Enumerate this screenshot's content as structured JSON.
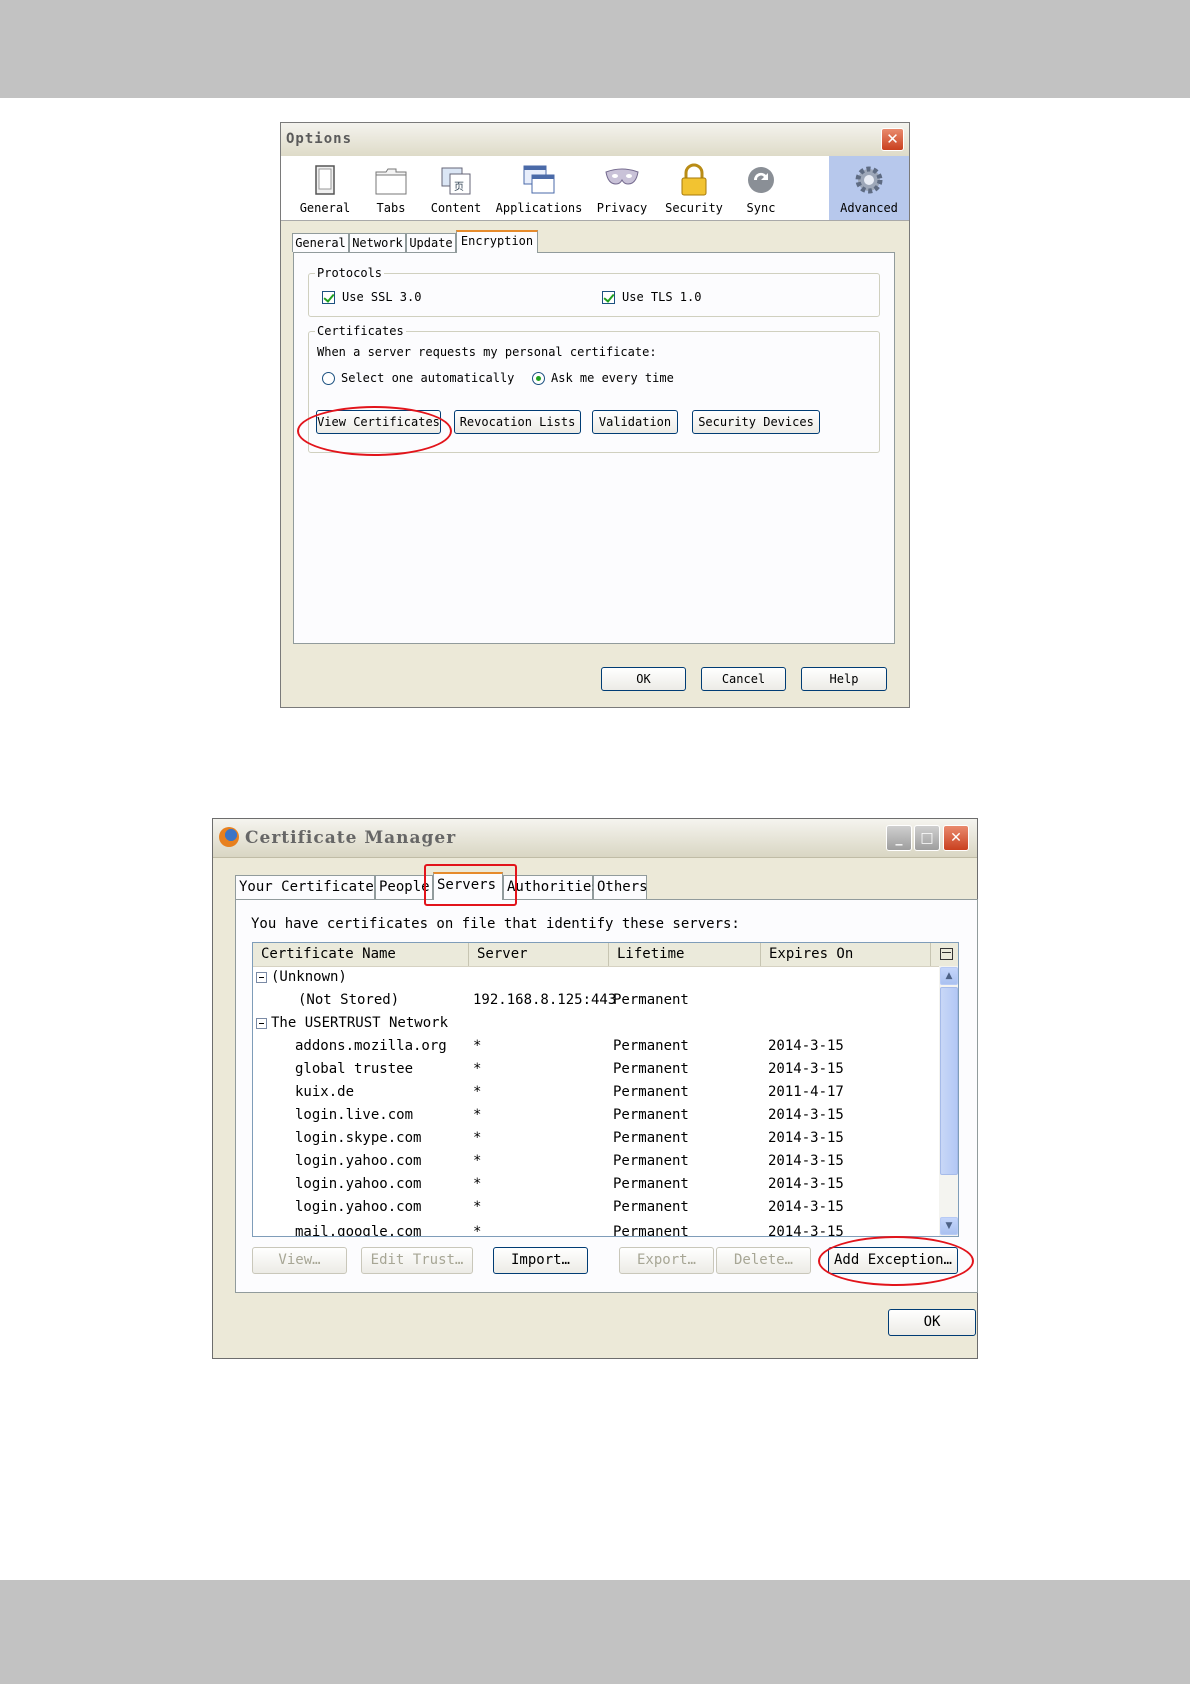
{
  "options_window": {
    "title": "Options",
    "close_glyph": "✕",
    "panels": [
      {
        "label": "General",
        "icon": "general-icon"
      },
      {
        "label": "Tabs",
        "icon": "tabs-icon"
      },
      {
        "label": "Content",
        "icon": "content-icon"
      },
      {
        "label": "Applications",
        "icon": "applications-icon"
      },
      {
        "label": "Privacy",
        "icon": "privacy-icon"
      },
      {
        "label": "Security",
        "icon": "security-icon"
      },
      {
        "label": "Sync",
        "icon": "sync-icon"
      },
      {
        "label": "Advanced",
        "icon": "advanced-icon",
        "selected": true
      }
    ],
    "subtabs": [
      "General",
      "Network",
      "Update",
      "Encryption"
    ],
    "active_subtab": "Encryption",
    "protocols": {
      "legend": "Protocols",
      "ssl_label": "Use SSL 3.0",
      "ssl_checked": true,
      "tls_label": "Use TLS 1.0",
      "tls_checked": true
    },
    "certificates": {
      "legend": "Certificates",
      "prompt": "When a server requests my personal certificate:",
      "radio_auto": "Select one automatically",
      "radio_ask": "Ask me every time",
      "selected": "Ask me every time",
      "buttons": {
        "view": "View Certificates",
        "revocation": "Revocation Lists",
        "validation": "Validation",
        "devices": "Security Devices"
      }
    },
    "footer": {
      "ok": "OK",
      "cancel": "Cancel",
      "help": "Help"
    }
  },
  "cert_manager": {
    "title": "Certificate Manager",
    "controls": {
      "minimize": "_",
      "maximize": "□",
      "close": "✕"
    },
    "tabs": [
      "Your Certificates",
      "People",
      "Servers",
      "Authorities",
      "Others"
    ],
    "active_tab": "Servers",
    "description": "You have certificates on file that identify these servers:",
    "columns": [
      "Certificate Name",
      "Server",
      "Lifetime",
      "Expires On"
    ],
    "groups": [
      {
        "name": "(Unknown)",
        "rows": [
          {
            "name": "(Not Stored)",
            "server": "192.168.8.125:443",
            "lifetime": "Permanent",
            "expires": ""
          }
        ]
      },
      {
        "name": "The USERTRUST Network",
        "rows": [
          {
            "name": "addons.mozilla.org",
            "server": "*",
            "lifetime": "Permanent",
            "expires": "2014-3-15"
          },
          {
            "name": "global trustee",
            "server": "*",
            "lifetime": "Permanent",
            "expires": "2014-3-15"
          },
          {
            "name": "kuix.de",
            "server": "*",
            "lifetime": "Permanent",
            "expires": "2011-4-17"
          },
          {
            "name": "login.live.com",
            "server": "*",
            "lifetime": "Permanent",
            "expires": "2014-3-15"
          },
          {
            "name": "login.skype.com",
            "server": "*",
            "lifetime": "Permanent",
            "expires": "2014-3-15"
          },
          {
            "name": "login.yahoo.com",
            "server": "*",
            "lifetime": "Permanent",
            "expires": "2014-3-15"
          },
          {
            "name": "login.yahoo.com",
            "server": "*",
            "lifetime": "Permanent",
            "expires": "2014-3-15"
          },
          {
            "name": "login.yahoo.com",
            "server": "*",
            "lifetime": "Permanent",
            "expires": "2014-3-15"
          },
          {
            "name": "mail.google.com",
            "server": "*",
            "lifetime": "Permanent",
            "expires": "2014-3-15"
          }
        ]
      }
    ],
    "buttons": {
      "view": "View…",
      "edit_trust": "Edit Trust…",
      "import": "Import…",
      "export": "Export…",
      "delete": "Delete…",
      "add_exception": "Add Exception…"
    },
    "ok": "OK"
  },
  "colors": {
    "highlight": "#e2141b",
    "dialog_bg": "#ece9d8",
    "selected_panel": "#b7c8ec",
    "tab_accent": "#e68b2c"
  }
}
